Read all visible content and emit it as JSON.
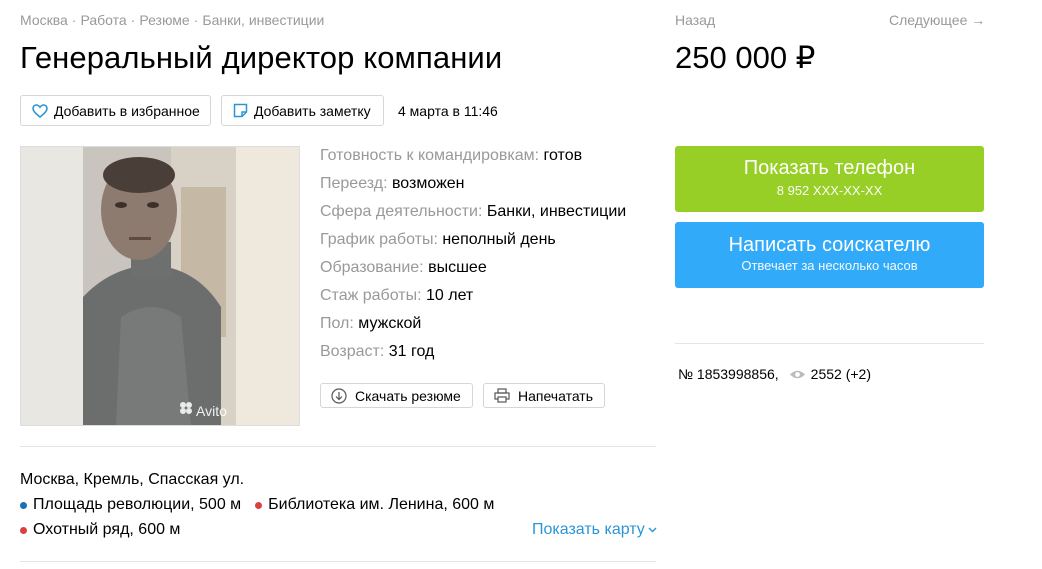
{
  "breadcrumbs": [
    "Москва",
    "Работа",
    "Резюме",
    "Банки, инвестиции"
  ],
  "title": "Генеральный директор компании",
  "actions": {
    "favorite_label": "Добавить в избранное",
    "note_label": "Добавить заметку",
    "date": "4 марта в 11:46"
  },
  "photo": {
    "watermark": "Avito"
  },
  "params": [
    {
      "key": "Готовность к командировкам:",
      "value": "готов"
    },
    {
      "key": "Переезд:",
      "value": "возможен"
    },
    {
      "key": "Сфера деятельности:",
      "value": "Банки, инвестиции"
    },
    {
      "key": "График работы:",
      "value": "неполный день"
    },
    {
      "key": "Образование:",
      "value": "высшее"
    },
    {
      "key": "Стаж работы:",
      "value": "10 лет"
    },
    {
      "key": "Пол:",
      "value": "мужской"
    },
    {
      "key": "Возраст:",
      "value": "31 год"
    }
  ],
  "resume_actions": {
    "download_label": "Скачать резюме",
    "print_label": "Напечатать"
  },
  "location": {
    "address": "Москва, Кремль, Спасская ул.",
    "metro": [
      {
        "name": "Площадь революции, 500 м",
        "color": "#1a6fb5"
      },
      {
        "name": "Библиотека им. Ленина, 600 м",
        "color": "#d9413e"
      },
      {
        "name": "Охотный ряд, 600 м",
        "color": "#d9413e"
      }
    ],
    "map_link": "Показать карту"
  },
  "nav": {
    "back": "Назад",
    "next": "Следующее →"
  },
  "price": "250 000 ₽",
  "contact": {
    "phone_label": "Показать телефон",
    "phone_masked": "8 952 XXX-XX-XX",
    "write_label": "Написать соискателю",
    "write_sub": "Отвечает за несколько часов",
    "phone_color": "#97cf26",
    "write_color": "#32aafa"
  },
  "meta": {
    "number": "№ 1853998856,",
    "views": "2552 (+2)"
  }
}
